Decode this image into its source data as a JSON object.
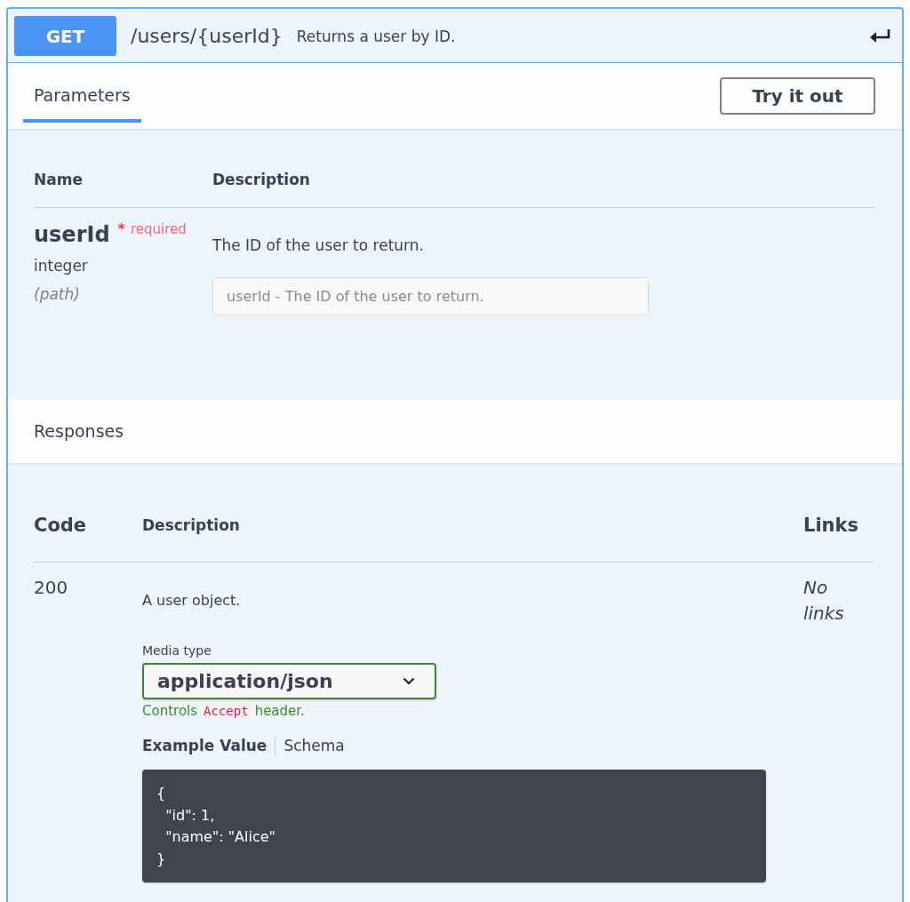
{
  "operation": {
    "method": "GET",
    "path": "/users/{userId}",
    "summary": "Returns a user by ID."
  },
  "tabs": [
    {
      "label": "Parameters",
      "selected": true
    }
  ],
  "try_button": "Try it out",
  "parameters": {
    "columns": [
      "Name",
      "Description"
    ],
    "rows": [
      {
        "name": "userId",
        "required_mark": "*",
        "required_label": "required",
        "type": "integer",
        "location": "(path)",
        "description": "The ID of the user to return.",
        "placeholder": "userId - The ID of the user to return."
      }
    ]
  },
  "responses": {
    "title": "Responses",
    "columns": [
      "Code",
      "Description",
      "Links"
    ],
    "rows": [
      {
        "code": "200",
        "description": "A user object.",
        "links": "No links",
        "media_type_label": "Media type",
        "media_type": "application/json",
        "note": {
          "before": "Controls",
          "code": "Accept",
          "after": "header."
        },
        "example_tabs": [
          {
            "label": "Example Value",
            "selected": true
          },
          {
            "label": "Schema",
            "selected": false
          }
        ],
        "example": "{\n  \"id\": 1,\n  \"name\": \"Alice\"\n}"
      }
    ]
  }
}
